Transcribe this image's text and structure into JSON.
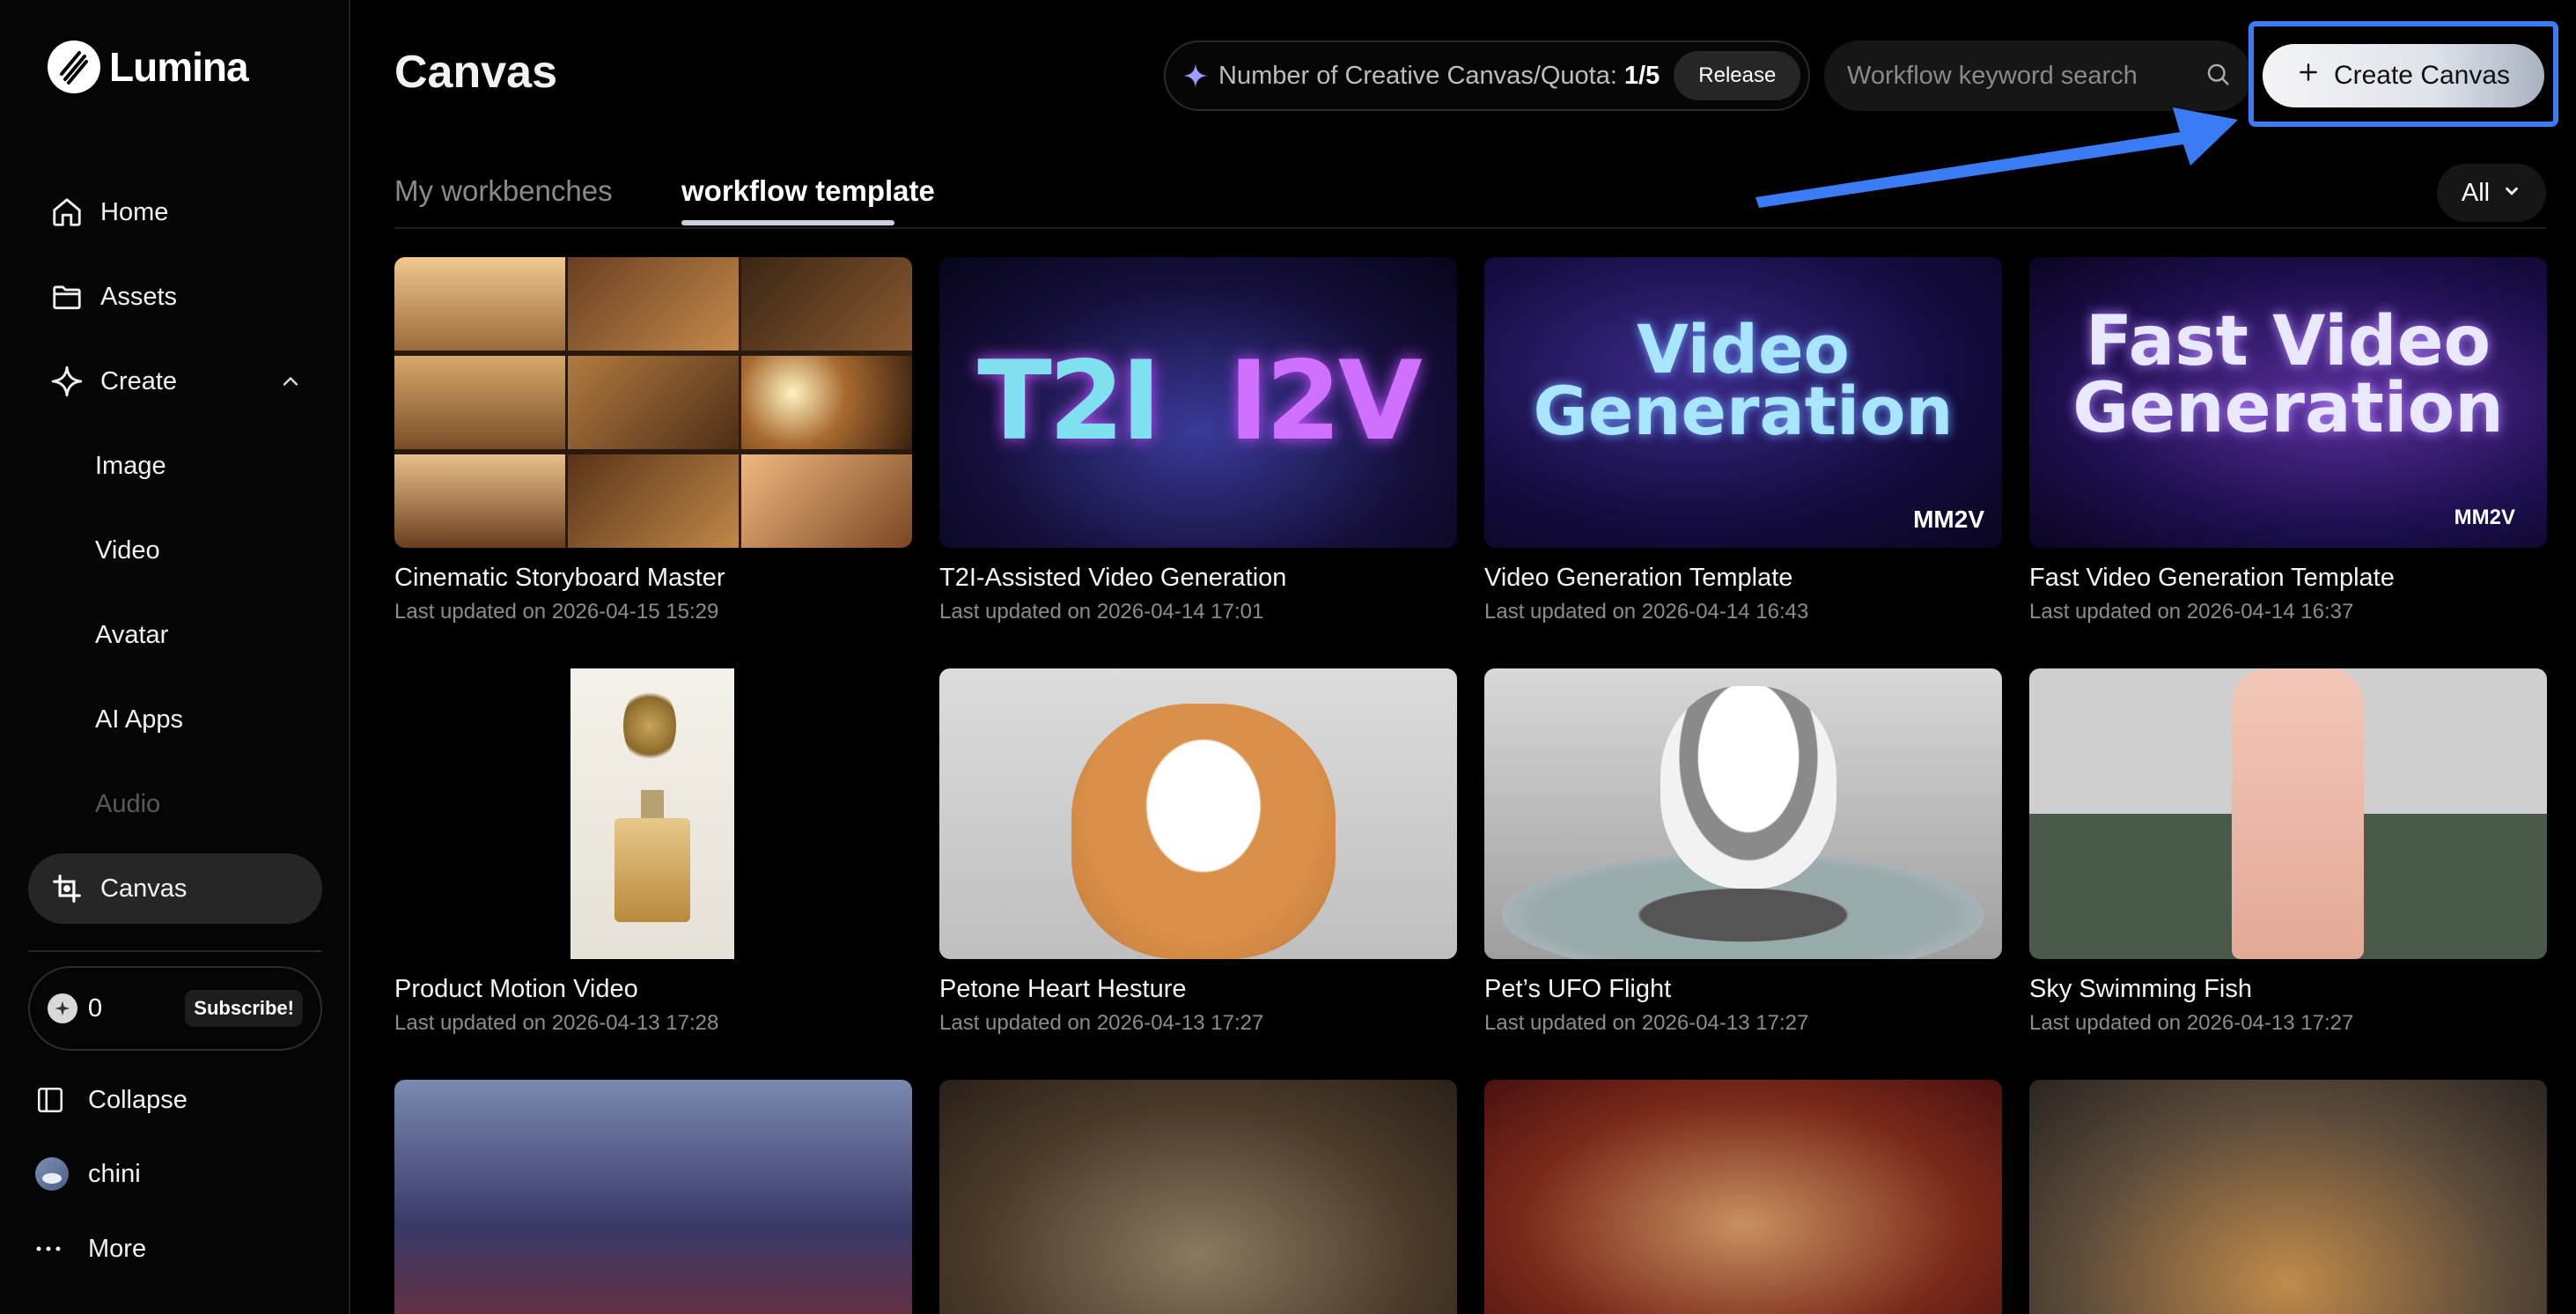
{
  "brand": {
    "name": "Lumina"
  },
  "sidebar": {
    "items": [
      {
        "label": "Home",
        "icon": "home-icon"
      },
      {
        "label": "Assets",
        "icon": "folder-icon"
      },
      {
        "label": "Create",
        "icon": "sparkle-icon"
      },
      {
        "label": "Image"
      },
      {
        "label": "Video"
      },
      {
        "label": "Avatar"
      },
      {
        "label": "AI Apps"
      },
      {
        "label": "Audio",
        "disabled": true
      },
      {
        "label": "Canvas",
        "icon": "canvas-icon",
        "active": true
      }
    ],
    "credits": {
      "count": "0",
      "subscribe_label": "Subscribe!"
    },
    "collapse_label": "Collapse",
    "user_name": "chini",
    "more_label": "More"
  },
  "header": {
    "title": "Canvas",
    "quota_label": "Number of Creative Canvas/Quota:",
    "quota_value": "1/5",
    "release_label": "Release",
    "search_placeholder": "Workflow keyword search",
    "create_label": "Create Canvas"
  },
  "tabs": [
    {
      "label": "My workbenches"
    },
    {
      "label": "workflow template",
      "active": true
    }
  ],
  "filter": {
    "value": "All"
  },
  "cards": [
    {
      "title": "Cinematic Storyboard Master",
      "date": "Last updated on 2026-04-15 15:29"
    },
    {
      "title": "T2I-Assisted Video Generation",
      "date": "Last updated on 2026-04-14 17:01",
      "thumb_text": [
        "T2I",
        "I2V"
      ]
    },
    {
      "title": "Video Generation Template",
      "date": "Last updated on 2026-04-14 16:43",
      "thumb_text": [
        "Video",
        "Generation"
      ],
      "badge": "MM2V"
    },
    {
      "title": "Fast Video Generation Template",
      "date": "Last updated on 2026-04-14 16:37",
      "thumb_text": [
        "Fast Video",
        "Generation"
      ],
      "badge": "MM2V"
    },
    {
      "title": "Product Motion Video",
      "date": "Last updated on 2026-04-13 17:28"
    },
    {
      "title": "Petone Heart Hesture",
      "date": "Last updated on 2026-04-13 17:27"
    },
    {
      "title": "Pet’s UFO Flight",
      "date": "Last updated on 2026-04-13 17:27"
    },
    {
      "title": "Sky Swimming Fish",
      "date": "Last updated on 2026-04-13 17:27"
    }
  ],
  "colors": {
    "accent": "#3b7cf4",
    "background": "#000000",
    "active_nav": "#262626"
  }
}
